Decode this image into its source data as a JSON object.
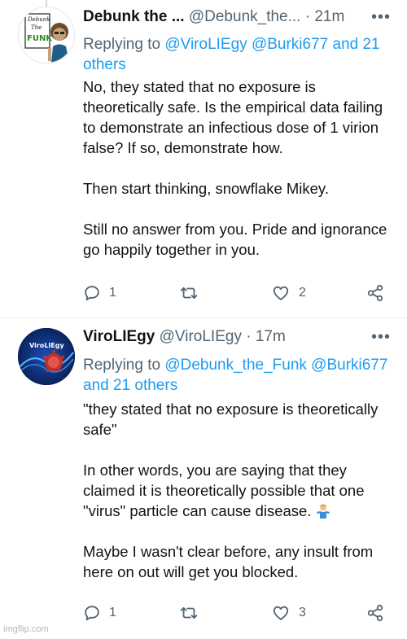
{
  "tweets": [
    {
      "display_name": "Debunk the ...",
      "handle": "@Debunk_the...",
      "separator": "·",
      "time": "21m",
      "more": "•••",
      "avatar_text": [
        "Debunk",
        "The",
        "FUNK"
      ],
      "reply_prefix": "Replying to",
      "reply_mentions": "@ViroLIEgy @Burki677 and 21 others",
      "paragraphs": [
        "No, they stated that no exposure is theoretically safe. Is the empirical data failing to demonstrate an infectious dose of 1 virion false? If so, demonstrate how.",
        "Then start thinking, snowflake Mikey.",
        "Still no answer from you. Pride and ignorance go happily together in you."
      ],
      "actions": {
        "replies": "1",
        "retweets": "",
        "likes": "2"
      }
    },
    {
      "display_name": "ViroLIEgy",
      "handle": "@ViroLIEgy",
      "separator": "·",
      "time": "17m",
      "more": "•••",
      "avatar_text": [
        "ViroLIEgy"
      ],
      "reply_prefix": "Replying to",
      "reply_mentions": "@Debunk_the_Funk @Burki677 and 21 others",
      "paragraphs": [
        "\"they stated that no exposure is theoretically safe\"",
        "In other words, you are saying that they claimed it is theoretically possible that one \"virus\" particle can cause disease.",
        "Maybe I wasn't clear before, any insult from here on out will get you blocked."
      ],
      "actions": {
        "replies": "1",
        "retweets": "",
        "likes": "3"
      }
    }
  ],
  "watermark": "imgflip.com",
  "colors": {
    "link": "#1d9bf0",
    "muted": "#536471",
    "text": "#0f1419"
  }
}
